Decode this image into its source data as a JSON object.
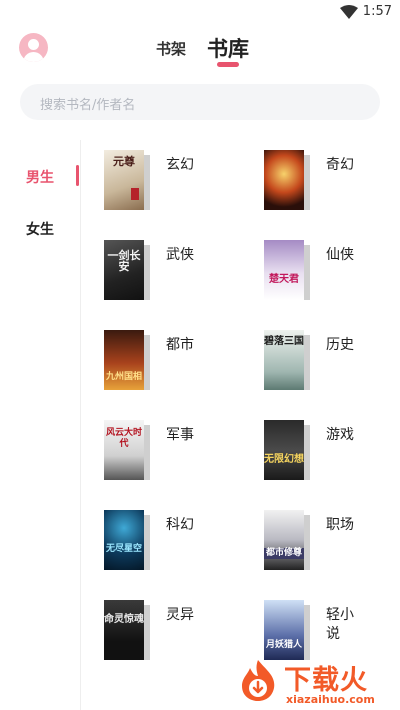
{
  "status_bar": {
    "time": "1:57"
  },
  "header": {
    "tabs": [
      {
        "label": "书架"
      },
      {
        "label": "书库"
      }
    ]
  },
  "search": {
    "placeholder": "搜索书名/作者名"
  },
  "sidebar": {
    "items": [
      {
        "label": "男生",
        "active": true
      },
      {
        "label": "女生",
        "active": false
      }
    ]
  },
  "categories": [
    {
      "label": "玄幻",
      "cover_text": "元尊"
    },
    {
      "label": "奇幻",
      "cover_text": ""
    },
    {
      "label": "武侠",
      "cover_text": "一剑长安"
    },
    {
      "label": "仙侠",
      "cover_text": "楚天君"
    },
    {
      "label": "都市",
      "cover_text": "九州国相"
    },
    {
      "label": "历史",
      "cover_text": "碧落三国"
    },
    {
      "label": "军事",
      "cover_text": "风云大时代"
    },
    {
      "label": "游戏",
      "cover_text": "无限幻想"
    },
    {
      "label": "科幻",
      "cover_text": "无尽星空"
    },
    {
      "label": "职场",
      "cover_text": "都市修尊"
    },
    {
      "label": "灵异",
      "cover_text": "命灵惊魂"
    },
    {
      "label": "轻小说",
      "cover_text": "月妖猎人"
    }
  ],
  "watermark": {
    "name": "下载火",
    "url": "xiazaihuo.com"
  },
  "colors": {
    "accent": "#e8546e",
    "watermark": "#f25a28"
  }
}
